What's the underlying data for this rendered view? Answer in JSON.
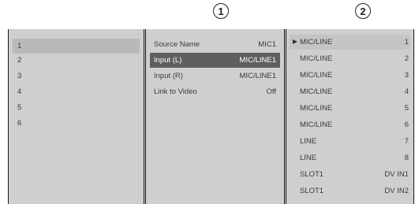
{
  "callouts": [
    "1",
    "2"
  ],
  "channels": {
    "items": [
      "1",
      "2",
      "3",
      "4",
      "5",
      "6"
    ],
    "selected_index": 0
  },
  "settings": {
    "rows": [
      {
        "label": "Source Name",
        "value": "MIC1"
      },
      {
        "label": "Input (L)",
        "value": "MIC/LINE1"
      },
      {
        "label": "Input (R)",
        "value": "MIC/LINE1"
      },
      {
        "label": "Link to Video",
        "value": "Off"
      }
    ],
    "selected_index": 1
  },
  "options": {
    "rows": [
      {
        "label": "MIC/LINE",
        "value": "1"
      },
      {
        "label": "MIC/LINE",
        "value": "2"
      },
      {
        "label": "MIC/LINE",
        "value": "3"
      },
      {
        "label": "MIC/LINE",
        "value": "4"
      },
      {
        "label": "MIC/LINE",
        "value": "5"
      },
      {
        "label": "MIC/LINE",
        "value": "6"
      },
      {
        "label": "LINE",
        "value": "7"
      },
      {
        "label": "LINE",
        "value": "8"
      },
      {
        "label": "SLOT1",
        "value": "DV IN1"
      },
      {
        "label": "SLOT1",
        "value": "DV IN2"
      }
    ],
    "selected_index": 0,
    "cursor_icon": "triangle-right-icon"
  },
  "colors": {
    "screen_bg": "#cfcfcf",
    "mid_highlight": "#5f5f5f",
    "left_highlight": "#b9b9b9"
  }
}
